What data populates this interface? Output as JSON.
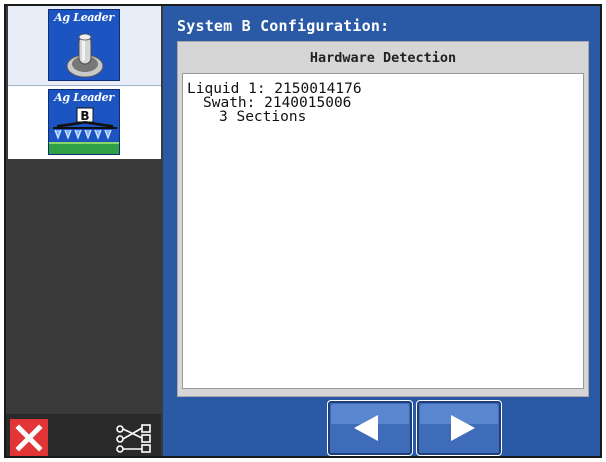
{
  "sidebar": {
    "tiles": [
      {
        "brand": "Ag Leader",
        "icon": "toggle-switch-icon"
      },
      {
        "brand": "Ag Leader",
        "badge": "B",
        "icon": "sprayer-boom-icon"
      }
    ],
    "close_icon": "close-icon",
    "link_icon": "device-link-icon"
  },
  "panel": {
    "title": "System B Configuration:",
    "heading": "Hardware Detection",
    "lines": [
      "Liquid 1: 2150014176",
      "Swath: 2140015006",
      "3 Sections"
    ]
  },
  "nav": {
    "prev_icon": "arrow-left-icon",
    "next_icon": "arrow-right-icon"
  },
  "colors": {
    "panel_blue": "#2a5aa5",
    "app_icon_blue": "#1c55c2",
    "close_red": "#e23535",
    "sidebar_dark": "#3a3a3a"
  }
}
